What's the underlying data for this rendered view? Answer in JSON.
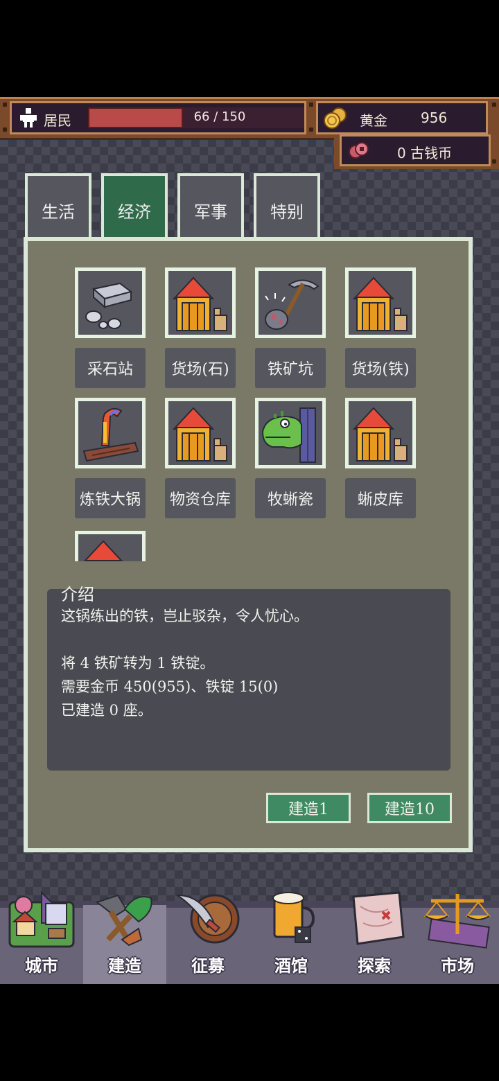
{
  "resources": {
    "resident_label": "居民",
    "resident_value": "66 / 150",
    "resident_fill": 0.44,
    "gold_label": "黄金",
    "gold_value": "956",
    "coin_value": "0 古钱币"
  },
  "tabs": [
    {
      "label": "生活",
      "active": false
    },
    {
      "label": "经济",
      "active": true
    },
    {
      "label": "军事",
      "active": false
    },
    {
      "label": "特别",
      "active": false
    }
  ],
  "buildings": [
    {
      "label": "采石站",
      "icon": "stone-pile-icon"
    },
    {
      "label": "货场(石)",
      "icon": "warehouse-icon"
    },
    {
      "label": "铁矿坑",
      "icon": "pickaxe-ore-icon"
    },
    {
      "label": "货场(铁)",
      "icon": "warehouse-icon"
    },
    {
      "label": "炼铁大锅",
      "icon": "smelter-icon"
    },
    {
      "label": "物资仓库",
      "icon": "warehouse-icon"
    },
    {
      "label": "牧蜥瓷",
      "icon": "lizard-icon"
    },
    {
      "label": "蜥皮库",
      "icon": "warehouse-icon"
    },
    {
      "label": "",
      "icon": "warehouse-icon"
    }
  ],
  "description": {
    "title": "介绍",
    "line1": "这锅练出的铁，岂止驳杂，令人忧心。",
    "line2": "将 4 铁矿转为 1 铁锭。",
    "line3": "需要金币 450(955)、铁锭 15(0)",
    "line4": "已建造 0 座。"
  },
  "buttons": {
    "build1": "建造1",
    "build10": "建造10"
  },
  "nav": [
    {
      "label": "城市",
      "icon": "city-icon",
      "active": false
    },
    {
      "label": "建造",
      "icon": "shovel-icon",
      "active": true
    },
    {
      "label": "征募",
      "icon": "sword-shield-icon",
      "active": false
    },
    {
      "label": "酒馆",
      "icon": "beer-icon",
      "active": false
    },
    {
      "label": "探索",
      "icon": "map-icon",
      "active": false
    },
    {
      "label": "市场",
      "icon": "scales-icon",
      "active": false
    }
  ],
  "colors": {
    "panel": "#7a7866",
    "accent": "#3f8a62",
    "frame": "#dbe8d8"
  }
}
